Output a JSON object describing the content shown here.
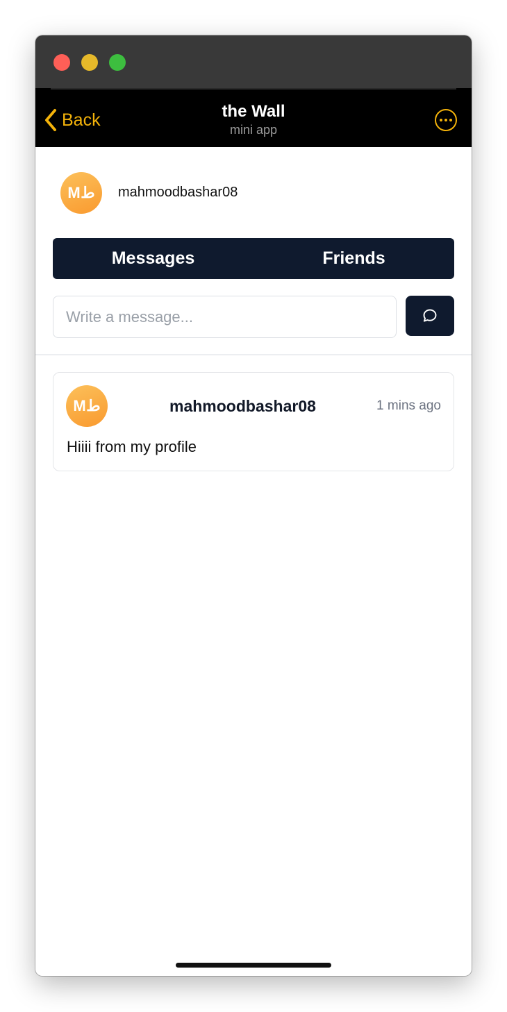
{
  "window": {
    "controls": [
      "close",
      "minimize",
      "zoom"
    ],
    "colors": {
      "close": "#fe5f57",
      "minimize": "#e6b92a",
      "zoom": "#3dbe3f"
    }
  },
  "navbar": {
    "back_label": "Back",
    "title": "the Wall",
    "subtitle": "mini app",
    "accent_color": "#f4b30a",
    "back_icon": "chevron-left-icon",
    "more_icon": "ellipsis-circle-icon"
  },
  "profile": {
    "avatar_text": "Mط",
    "username": "mahmoodbashar08"
  },
  "tabs": [
    {
      "label": "Messages"
    },
    {
      "label": "Friends"
    }
  ],
  "composer": {
    "placeholder": "Write a message...",
    "value": "",
    "send_icon": "chat-bubble-icon"
  },
  "messages": [
    {
      "avatar_text": "Mط",
      "username": "mahmoodbashar08",
      "time": "1 mins ago",
      "text": "Hiiii from my profile"
    }
  ]
}
